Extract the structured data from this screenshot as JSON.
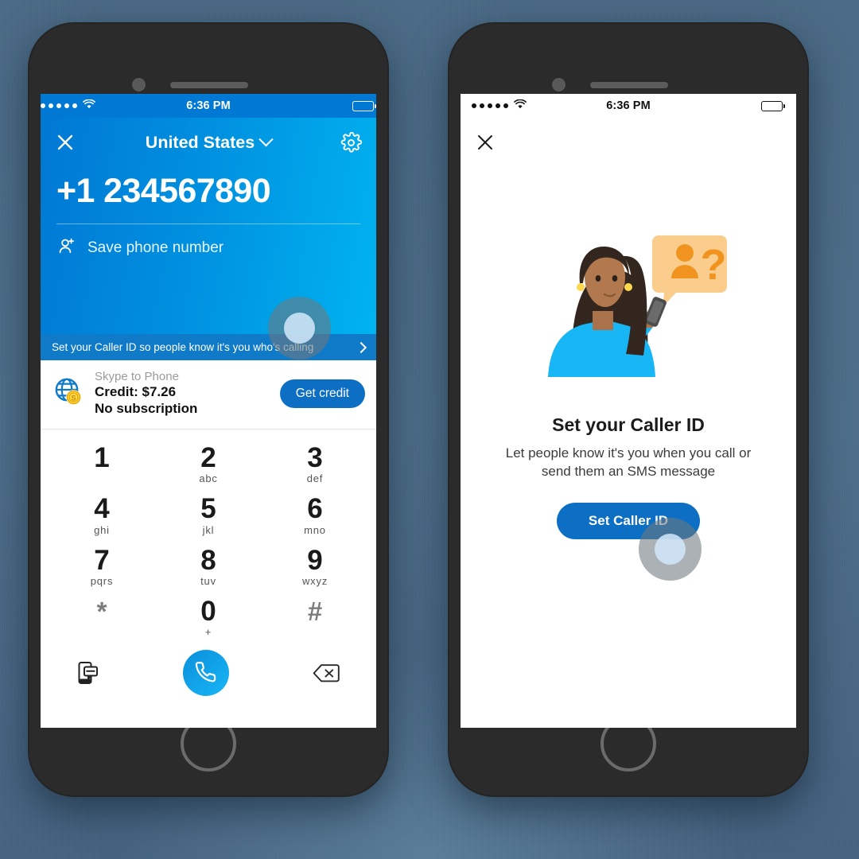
{
  "theme": {
    "brand_blue": "#0078d4",
    "light_blue": "#00b3f0",
    "banner_blue": "#0f7ac8",
    "button_blue": "#0d6fc4",
    "background": "#4d6e8a",
    "frame": "#2b2b2b"
  },
  "left_phone": {
    "status_bar": {
      "time": "6:36 PM",
      "signal_dots": 5,
      "wifi": "wifi-icon",
      "battery": "battery-full-icon"
    },
    "header": {
      "close_label": "×",
      "close_icon": "close-icon",
      "country": "United States",
      "country_chevron": "chevron-down-icon",
      "settings_icon": "gear-icon",
      "phone_number": "+1 234567890",
      "save_number_label": "Save phone number",
      "save_number_icon": "add-contact-icon"
    },
    "banner": {
      "text": "Set your Caller ID so people know it's you who's calling",
      "chevron": "chevron-right-icon"
    },
    "credit": {
      "icon": "globe-coin-icon",
      "product": "Skype to Phone",
      "credit_line": "Credit: $7.26",
      "subscription_line": "No subscription",
      "button_label": "Get credit"
    },
    "keypad": [
      {
        "digit": "1",
        "letters": ""
      },
      {
        "digit": "2",
        "letters": "abc"
      },
      {
        "digit": "3",
        "letters": "def"
      },
      {
        "digit": "4",
        "letters": "ghi"
      },
      {
        "digit": "5",
        "letters": "jkl"
      },
      {
        "digit": "6",
        "letters": "mno"
      },
      {
        "digit": "7",
        "letters": "pqrs"
      },
      {
        "digit": "8",
        "letters": "tuv"
      },
      {
        "digit": "9",
        "letters": "wxyz"
      },
      {
        "digit": "*",
        "letters": ""
      },
      {
        "digit": "0",
        "letters": "+"
      },
      {
        "digit": "#",
        "letters": ""
      }
    ],
    "actions": {
      "sms_icon": "sms-phone-icon",
      "call_icon": "phone-handset-icon",
      "backspace_icon": "backspace-icon"
    }
  },
  "right_phone": {
    "status_bar": {
      "time": "6:36 PM",
      "signal_dots": 5,
      "wifi": "wifi-icon",
      "battery": "battery-full-icon"
    },
    "close_icon": "close-icon",
    "illustration": "woman-with-phone-and-question-bubble-illustration",
    "title": "Set your Caller ID",
    "description": "Let people know it's you when you call or send them an SMS message",
    "button_label": "Set Caller ID"
  },
  "overlays": {
    "tap_banner": "tap-indicator",
    "tap_caller_id": "tap-indicator"
  }
}
